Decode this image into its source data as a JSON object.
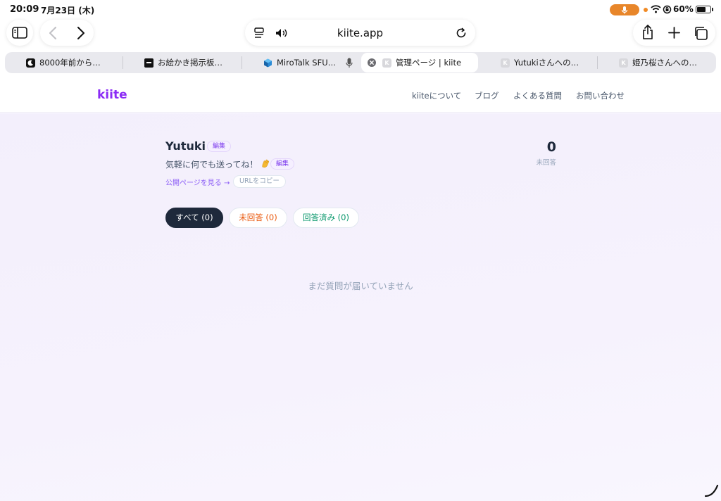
{
  "status_bar": {
    "time": "20:09",
    "date": "7月23日 (木)",
    "battery": "60%",
    "mic_color": "#e8862a"
  },
  "toolbar": {
    "address": "kiite.app",
    "icons": [
      "sidebar-icon",
      "back-icon",
      "forward-icon",
      "reader-icon",
      "speaker-icon",
      "reload-icon",
      "share-icon",
      "plus-icon",
      "tabs-overview-icon"
    ]
  },
  "tabs": [
    {
      "label": "8000年前から…",
      "favicon": "moon"
    },
    {
      "label": "お絵かき掲示板…",
      "favicon": "board"
    },
    {
      "label": "MiroTalk SFU…",
      "favicon": "cube"
    },
    {
      "label": "管理ページ | kiite",
      "favicon": "K",
      "active": true
    },
    {
      "label": "Yutukiさんへの…",
      "favicon": "K"
    },
    {
      "label": "姫乃桜さんへの…",
      "favicon": "K"
    }
  ],
  "site": {
    "logo": "kiite",
    "brand_color": "#8b2cf5",
    "nav": [
      "kiiteについて",
      "ブログ",
      "よくある質問",
      "お問い合わせ"
    ]
  },
  "profile": {
    "name": "Yutuki",
    "edit_label": "編集",
    "bio": "気軽に何でも送ってね！",
    "bio_edit_label": "編集",
    "public_link": "公開ページを見る →",
    "copy_url": "URLをコピー",
    "unanswered_count": "0",
    "unanswered_label": "未回答"
  },
  "filters": {
    "all": "すべて (0)",
    "unanswered": "未回答 (0)",
    "answered": "回答済み (0)"
  },
  "empty_message": "まだ質問が届いていません"
}
